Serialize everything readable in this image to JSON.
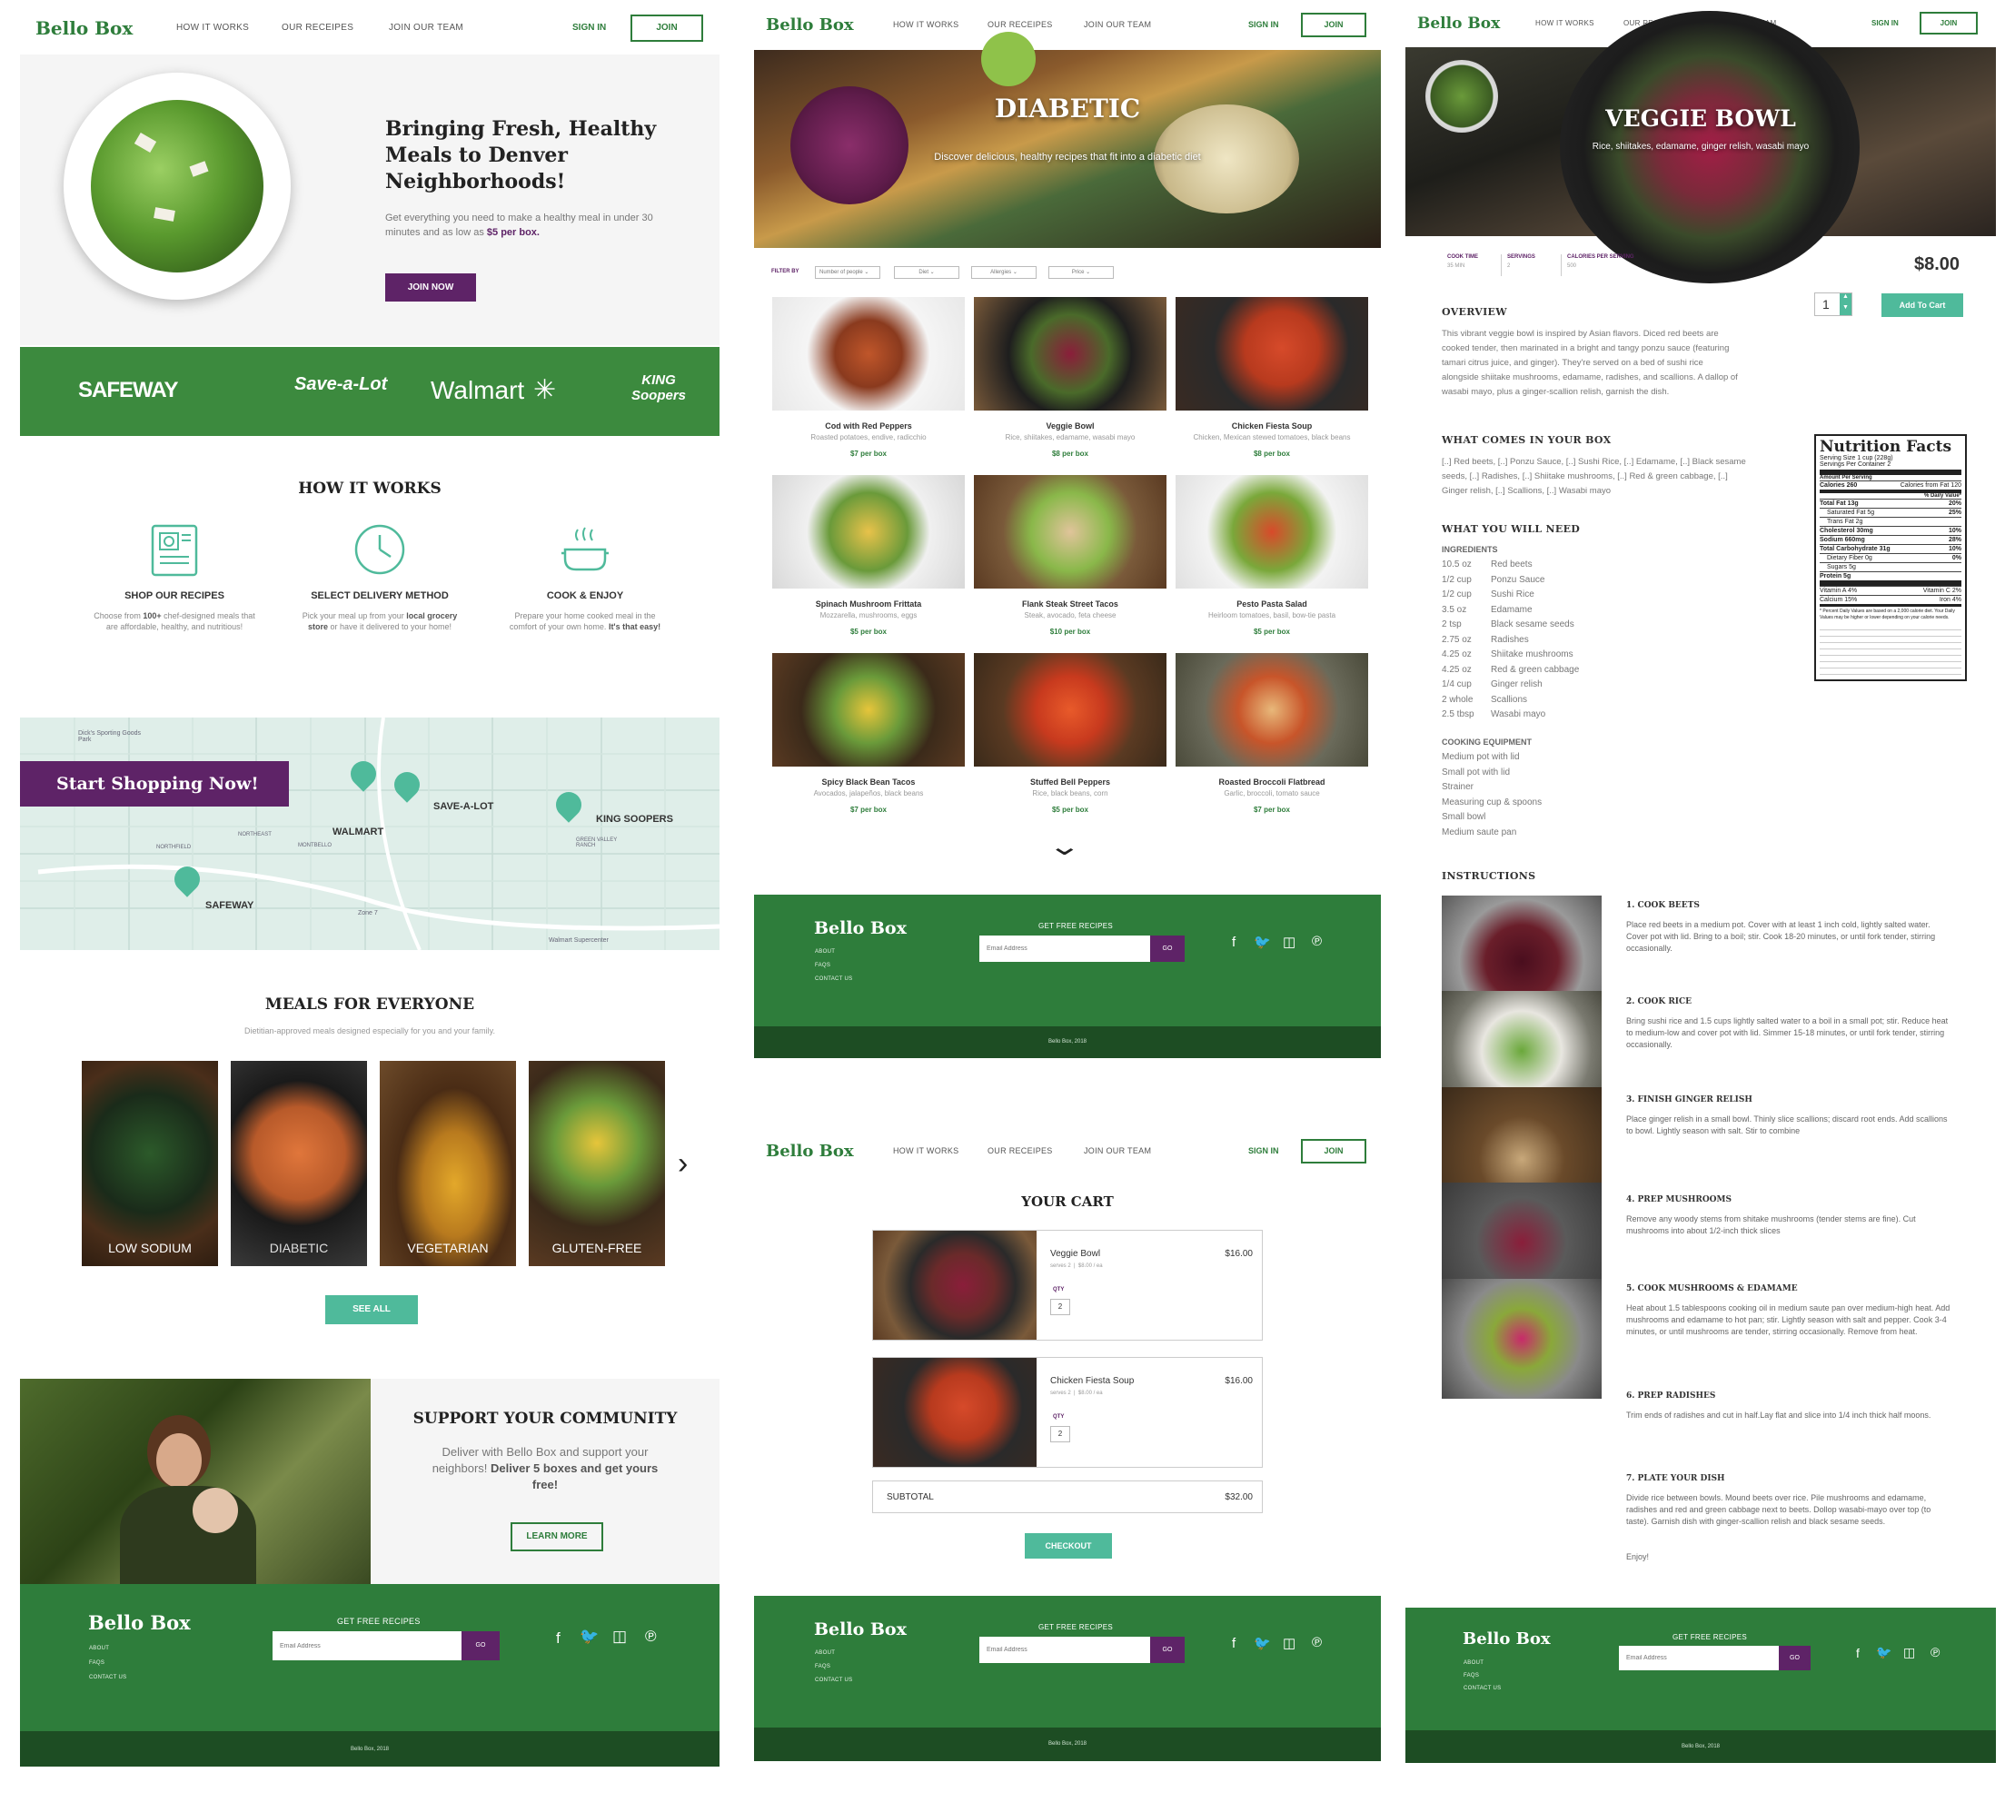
{
  "brand": "Bello Box",
  "nav": {
    "how": "HOW IT WORKS",
    "recipes": "OUR RECEIPES",
    "team": "JOIN OUR TEAM",
    "signin": "SIGN IN",
    "join": "JOIN"
  },
  "colors": {
    "green": "#2e7d3b",
    "dark_green": "#1d4d23",
    "purple": "#5e2367",
    "teal": "#4fba9b"
  },
  "home": {
    "hero_title": "Bringing Fresh, Healthy Meals to Denver Neighborhoods!",
    "hero_text": "Get everything you need to make a healthy meal in under 30 minutes and as low as",
    "hero_price": "$5 per box.",
    "join_now": "JOIN NOW",
    "partners": [
      "SAFEWAY",
      "Save-a-Lot",
      "Walmart",
      "KING Soopers"
    ],
    "how_title": "HOW IT WORKS",
    "steps": [
      {
        "title": "SHOP OUR RECIPES",
        "text_a": "Choose from",
        "text_b": "100+",
        "text_c": "chef-designed meals that are affordable, healthy, and nutritious!"
      },
      {
        "title": "SELECT DELIVERY METHOD",
        "text_a": "Pick your meal up from your",
        "text_b": "local grocery store",
        "text_c": "or have it delivered to your home!"
      },
      {
        "title": "COOK & ENJOY",
        "text_a": "Prepare your home cooked meal in the comfort of your own home.",
        "text_b": "It's that easy!",
        "text_c": ""
      }
    ],
    "map": {
      "cta": "Start Shopping Now!",
      "labels": [
        "SAVE-A-LOT",
        "WALMART",
        "KING SOOPERS",
        "SAFEWAY",
        "Dick's Sporting Goods Park",
        "NORTHEAST",
        "NORTHFIELD",
        "MONTBELLO",
        "GREEN VALLEY RANCH",
        "Zone 7",
        "Walmart Supercenter"
      ]
    },
    "meals_title": "MEALS FOR EVERYONE",
    "meals_sub": "Dietitian-approved meals designed especially for you and your family.",
    "categories": [
      "LOW SODIUM",
      "DIABETIC",
      "VEGETARIAN",
      "GLUTEN-FREE"
    ],
    "see_all": "SEE ALL",
    "community_title": "SUPPORT YOUR COMMUNITY",
    "community_text": "Deliver with Bello Box and support your neighbors!",
    "community_bold": "Deliver 5 boxes and get yours free!",
    "learn_more": "LEARN MORE"
  },
  "footer": {
    "get_recipes": "GET FREE RECIPES",
    "email_placeholder": "Email Address",
    "go": "GO",
    "links": [
      "ABOUT",
      "FAQS",
      "CONTACT US"
    ],
    "copyright": "Bello Box, 2018"
  },
  "diabetic": {
    "title": "DIABETIC",
    "subtitle": "Discover delicious, healthy recipes that fit into a diabetic diet",
    "filter_label": "FILTER BY",
    "filters": [
      "Number of people",
      "Diet",
      "Allergies",
      "Price"
    ],
    "recipes": [
      {
        "name": "Cod with Red Peppers",
        "desc": "Roasted potatoes, endive, radicchio",
        "price": "$7 per box"
      },
      {
        "name": "Veggie Bowl",
        "desc": "Rice, shiitakes, edamame, wasabi mayo",
        "price": "$8 per box"
      },
      {
        "name": "Chicken Fiesta Soup",
        "desc": "Chicken, Mexican stewed tomatoes, black beans",
        "price": "$8 per box"
      },
      {
        "name": "Spinach Mushroom Frittata",
        "desc": "Mozzarella, mushrooms, eggs",
        "price": "$5 per box"
      },
      {
        "name": "Flank Steak Street Tacos",
        "desc": "Steak, avocado, feta cheese",
        "price": "$10 per box"
      },
      {
        "name": "Pesto Pasta Salad",
        "desc": "Heirloom tomatoes, basil, bow-tie pasta",
        "price": "$5 per box"
      },
      {
        "name": "Spicy Black Bean Tacos",
        "desc": "Avocados, jalapeños, black beans",
        "price": "$7 per box"
      },
      {
        "name": "Stuffed Bell Peppers",
        "desc": "Rice, black beans, corn",
        "price": "$5 per box"
      },
      {
        "name": "Roasted Broccoli Flatbread",
        "desc": "Garlic, broccoli, tomato sauce",
        "price": "$7 per box"
      }
    ]
  },
  "cart": {
    "title": "YOUR CART",
    "items": [
      {
        "name": "Veggie Bowl",
        "meta": "serves 2  |  $8.00 / ea",
        "price": "$16.00",
        "qty_label": "QTY",
        "qty": "2"
      },
      {
        "name": "Chicken Fiesta Soup",
        "meta": "serves 2  |  $8.00 / ea",
        "price": "$16.00",
        "qty_label": "QTY",
        "qty": "2"
      }
    ],
    "subtotal_label": "SUBTOTAL",
    "subtotal": "$32.00",
    "checkout": "CHECKOUT"
  },
  "veggie": {
    "title": "VEGGIE BOWL",
    "subtitle": "Rice, shiitakes, edamame, ginger relish, wasabi mayo",
    "stats": [
      {
        "label": "COOK TIME",
        "value": "35 MIN"
      },
      {
        "label": "SERVINGS",
        "value": "2"
      },
      {
        "label": "CALORIES PER SERVING",
        "value": "500"
      }
    ],
    "price": "$8.00",
    "qty": "1",
    "add_to_cart": "Add To Cart",
    "overview_title": "OVERVIEW",
    "overview": "This vibrant veggie bowl is inspired by Asian flavors. Diced red beets are cooked tender, then marinated in a bright and tangy ponzu sauce (featuring tamari citrus juice, and ginger). They're served on a bed of sushi rice alongside shiitake mushrooms, edamame, radishes, and scallions. A dallop of wasabi mayo, plus a ginger-scallion relish, garnish the dish.",
    "box_title": "WHAT COMES IN YOUR BOX",
    "box_text": "[..] Red beets, [..] Ponzu Sauce, [..] Sushi Rice, [..] Edamame, [..] Black sesame seeds, [..] Radishes, [..] Shiitake mushrooms, [..] Red & green cabbage, [..] Ginger relish, [..] Scallions, [..] Wasabi mayo",
    "need_title": "WHAT YOU WILL NEED",
    "ingredients_label": "INGREDIENTS",
    "ingredients": [
      {
        "q": "10.5 oz",
        "n": "Red beets"
      },
      {
        "q": "1/2 cup",
        "n": "Ponzu Sauce"
      },
      {
        "q": "1/2 cup",
        "n": "Sushi Rice"
      },
      {
        "q": "3.5 oz",
        "n": "Edamame"
      },
      {
        "q": "2 tsp",
        "n": "Black sesame seeds"
      },
      {
        "q": "2.75 oz",
        "n": "Radishes"
      },
      {
        "q": "4.25 oz",
        "n": "Shiitake mushrooms"
      },
      {
        "q": "4.25 oz",
        "n": "Red & green cabbage"
      },
      {
        "q": "1/4 cup",
        "n": "Ginger relish"
      },
      {
        "q": "2 whole",
        "n": "Scallions"
      },
      {
        "q": "2.5 tbsp",
        "n": "Wasabi mayo"
      }
    ],
    "equipment_label": "COOKING EQUIPMENT",
    "equipment": [
      "Medium pot with lid",
      "Small pot with lid",
      "Strainer",
      "Measuring cup & spoons",
      "Small bowl",
      "Medium saute pan"
    ],
    "instructions_title": "INSTRUCTIONS",
    "steps": [
      {
        "t": "1. COOK BEETS",
        "d": "Place red beets in a medium pot. Cover with at least 1 inch cold, lightly salted water. Cover pot with lid. Bring to a boil; stir. Cook 18-20 minutes, or until fork tender, stirring occasionally."
      },
      {
        "t": "2. COOK RICE",
        "d": "Bring sushi rice and 1.5 cups lightly salted water to a boil in a small pot; stir. Reduce heat to medium-low and cover pot with lid. Simmer 15-18 minutes, or until fork tender, stirring occasionally."
      },
      {
        "t": "3. FINISH GINGER RELISH",
        "d": "Place ginger relish in a small bowl. Thinly slice scallions; discard root ends. Add scallions to bowl. Lightly season with salt. Stir to combine"
      },
      {
        "t": "4. PREP MUSHROOMS",
        "d": "Remove any woody stems from shitake mushrooms (tender stems are fine). Cut mushrooms into about 1/2-inch thick slices"
      },
      {
        "t": "5. COOK MUSHROOMS & EDAMAME",
        "d": "Heat about 1.5 tablespoons cooking oil in medium saute pan over medium-high heat. Add mushrooms and edamame to hot pan; stir. Lightly season with salt and pepper. Cook 3-4 minutes, or until mushrooms are tender, stirring occasionally. Remove from heat."
      },
      {
        "t": "6. PREP RADISHES",
        "d": "Trim ends of radishes and cut in half.Lay flat and slice into 1/4 inch thick half moons."
      },
      {
        "t": "7. PLATE YOUR DISH",
        "d": "Divide rice between bowls. Mound beets over rice. Pile mushrooms and edamame, radishes and red and green cabbage next to beets. Dollop wasabi-mayo over top (to taste). Garnish dish with ginger-scallion relish and black sesame seeds."
      }
    ],
    "enjoy": "Enjoy!",
    "nutrition": {
      "title": "Nutrition Facts",
      "serving": "Serving Size 1 cup (228g)",
      "per_container": "Servings Per Container 2",
      "amount": "Amount Per Serving",
      "calories": "Calories 260",
      "fat_cal": "Calories from Fat 120",
      "dv": "% Daily Value*",
      "rows": [
        {
          "n": "Total Fat 13g",
          "v": "20%"
        },
        {
          "n": "Saturated Fat 5g",
          "v": "25%"
        },
        {
          "n": "Trans Fat 2g",
          "v": ""
        },
        {
          "n": "Cholesterol 30mg",
          "v": "10%"
        },
        {
          "n": "Sodium 660mg",
          "v": "28%"
        },
        {
          "n": "Total Carbohydrate 31g",
          "v": "10%"
        },
        {
          "n": "Dietary Fiber 0g",
          "v": "0%"
        },
        {
          "n": "Sugars 5g",
          "v": ""
        },
        {
          "n": "Protein 5g",
          "v": ""
        }
      ],
      "vit": [
        {
          "n": "Vitamin A 4%",
          "v": "Vitamin C 2%"
        },
        {
          "n": "Calcium 15%",
          "v": "Iron 4%"
        }
      ],
      "foot": "* Percent Daily Values are based on a 2,000 calorie diet. Your Daily Values may be higher or lower depending on your calorie needs."
    }
  }
}
